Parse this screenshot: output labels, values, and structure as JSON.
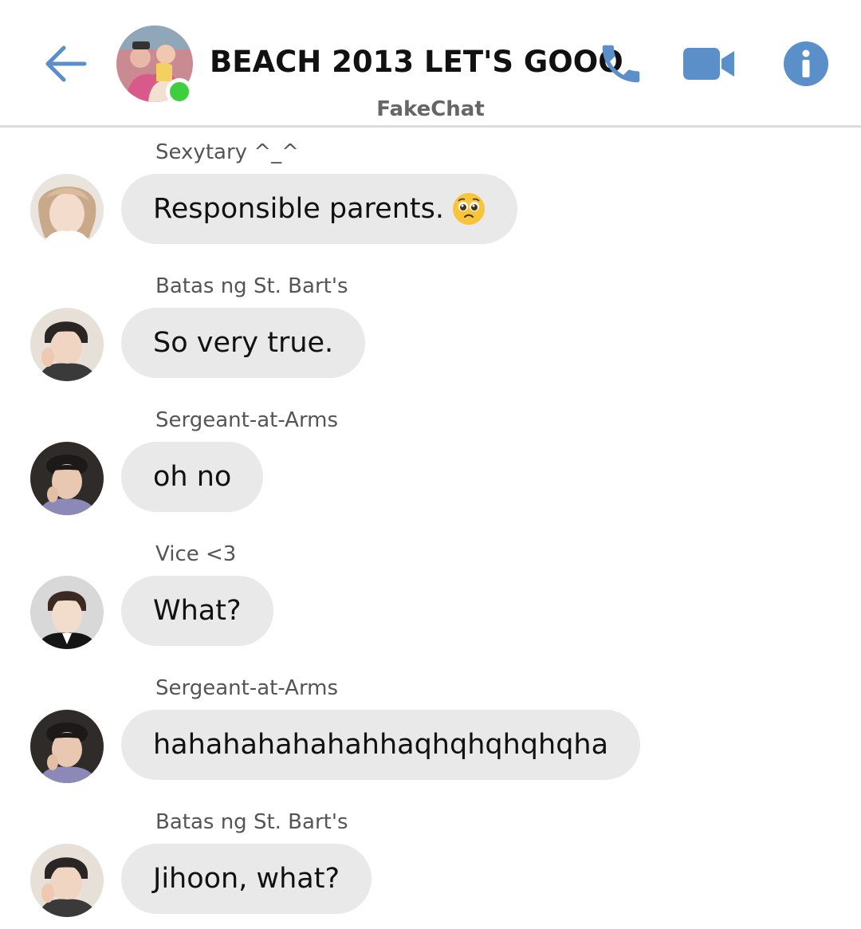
{
  "header": {
    "title": "BEACH 2013 LET'S GOOO",
    "subtitle": "FakeChat",
    "online": true,
    "icons": [
      "back-arrow-icon",
      "phone-icon",
      "video-camera-icon",
      "info-icon"
    ],
    "accent_color": "#5b8fc9",
    "online_color": "#3ecf3e"
  },
  "messages": [
    {
      "sender": "Sexytary ^_^",
      "text": "Responsible parents.",
      "emoji": "pleading-face-emoji",
      "avatar": "avatar-sexytary"
    },
    {
      "sender": "Batas ng St. Bart's",
      "text": "So very true.",
      "avatar": "avatar-batas"
    },
    {
      "sender": "Sergeant-at-Arms",
      "text": "oh no",
      "avatar": "avatar-sergeant"
    },
    {
      "sender": "Vice <3",
      "text": "What?",
      "avatar": "avatar-vice"
    },
    {
      "sender": "Sergeant-at-Arms",
      "text": "hahahahahahahhaqhqhqhqhqha",
      "avatar": "avatar-sergeant"
    },
    {
      "sender": "Batas ng St. Bart's",
      "text": "Jihoon, what?",
      "avatar": "avatar-batas"
    }
  ],
  "colors": {
    "bubble_bg": "#e9e9e9",
    "divider": "#dcdcdc"
  }
}
